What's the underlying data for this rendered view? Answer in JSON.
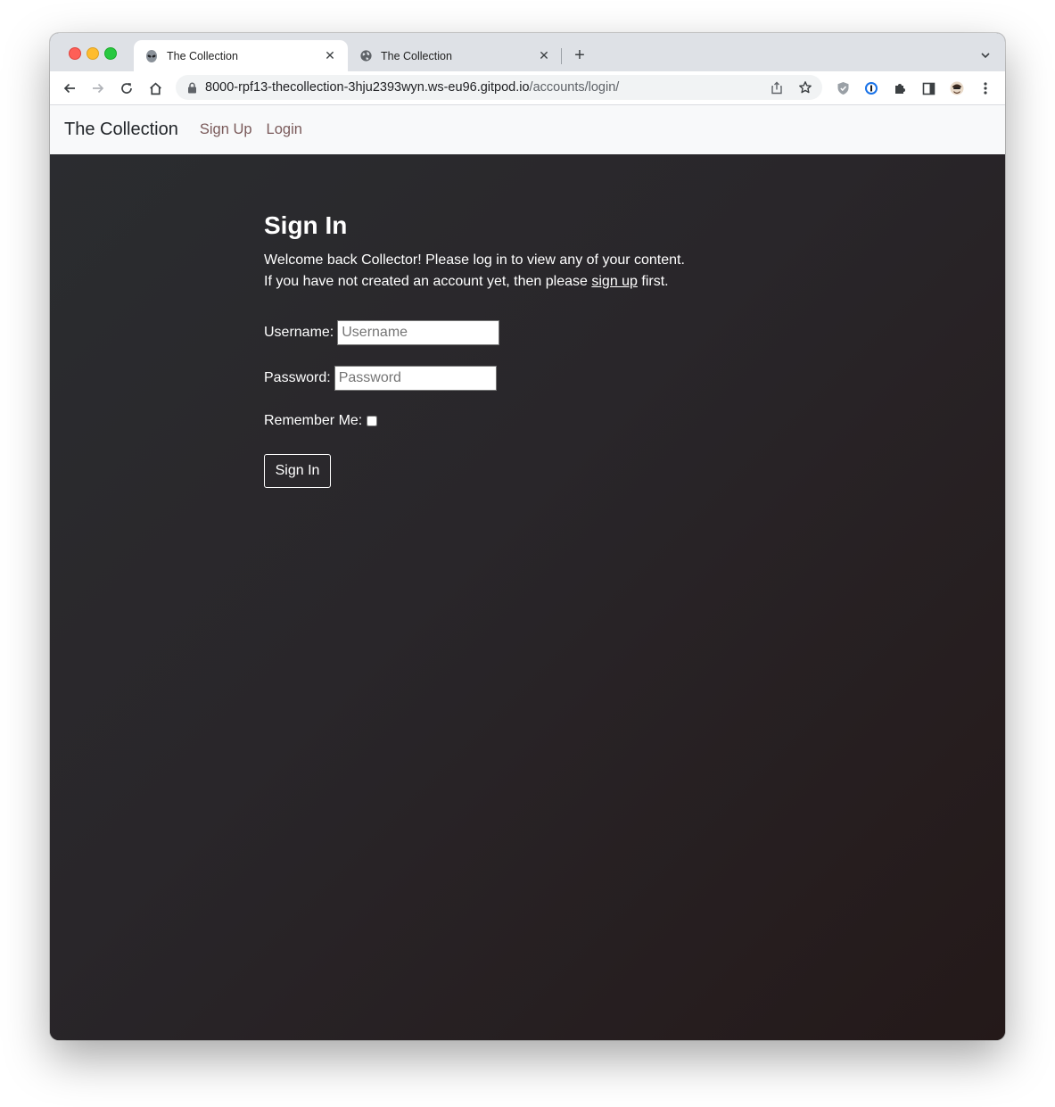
{
  "browser": {
    "tabs": [
      {
        "title": "The Collection",
        "icon": "alien-icon",
        "active": true
      },
      {
        "title": "The Collection",
        "icon": "globe-icon",
        "active": false
      }
    ],
    "address": {
      "host": "8000-rpf13-thecollection-3hju2393wyn.ws-eu96.gitpod.io",
      "path": "/accounts/login/"
    }
  },
  "navbar": {
    "brand": "The Collection",
    "links": [
      "Sign Up",
      "Login"
    ],
    "link_color": "#7a5a5a"
  },
  "main": {
    "heading": "Sign In",
    "intro_line1": "Welcome back Collector! Please log in to view any of your content.",
    "intro_line2_prefix": "If you have not created an account yet, then please ",
    "intro_link": "sign up",
    "intro_line2_suffix": " first.",
    "form": {
      "username_label": "Username:",
      "username_placeholder": "Username",
      "password_label": "Password:",
      "password_placeholder": "Password",
      "remember_label": "Remember Me:",
      "submit_label": "Sign In"
    }
  }
}
